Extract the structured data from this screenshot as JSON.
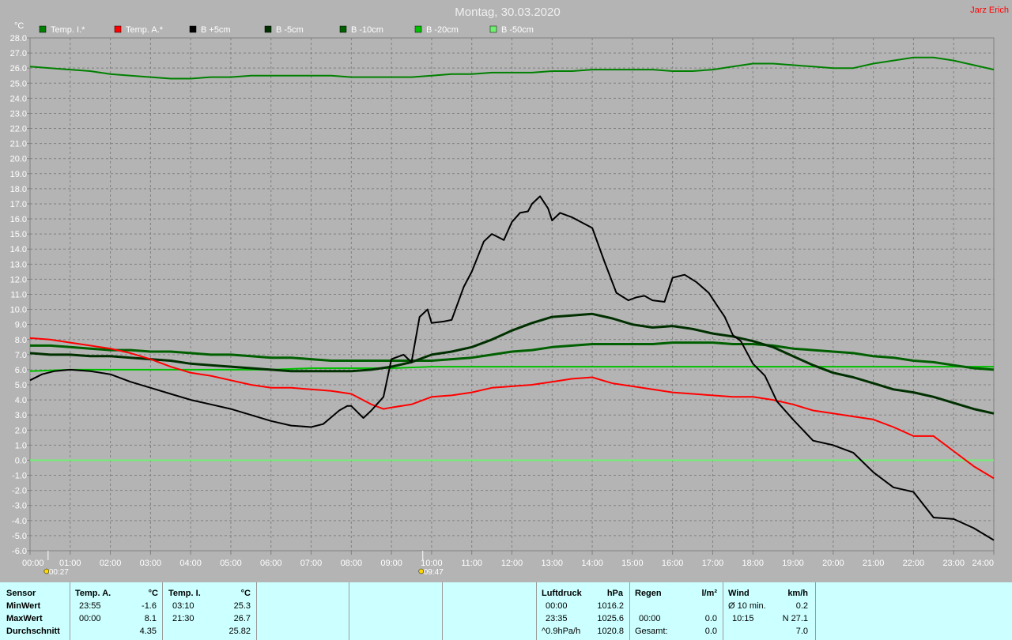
{
  "header": {
    "title": "Montag, 30.03.2020",
    "author": "Jarz Erich",
    "unit": "°C"
  },
  "colors": {
    "background": "#b4b4b4",
    "grid": "#808080",
    "title": "#f0f0f0",
    "author": "#ff0000",
    "axis_text": "#ffffff",
    "stats_bg": "#ccffff"
  },
  "chart_data": {
    "type": "line",
    "title": "Montag, 30.03.2020",
    "ylabel": "°C",
    "xlabel": "",
    "ylim": [
      -6,
      28
    ],
    "xlim": [
      0,
      24
    ],
    "grid": true,
    "legend_position": "top",
    "x_tick_labels": [
      "00:00",
      "01:00",
      "02:00",
      "03:00",
      "04:00",
      "05:00",
      "06:00",
      "07:00",
      "08:00",
      "09:00",
      "10:00",
      "11:00",
      "12:00",
      "13:00",
      "14:00",
      "15:00",
      "16:00",
      "17:00",
      "18:00",
      "19:00",
      "20:00",
      "21:00",
      "22:00",
      "23:00",
      "24:00"
    ],
    "y_tick_labels": [
      "28.0",
      "27.0",
      "26.0",
      "25.0",
      "24.0",
      "23.0",
      "22.0",
      "21.0",
      "20.0",
      "19.0",
      "18.0",
      "17.0",
      "16.0",
      "15.0",
      "14.0",
      "13.0",
      "12.0",
      "11.0",
      "10.0",
      "9.0",
      "8.0",
      "7.0",
      "6.0",
      "5.0",
      "4.0",
      "3.0",
      "2.0",
      "1.0",
      "0.0",
      "-1.0",
      "-2.0",
      "-3.0",
      "-4.0",
      "-5.0",
      "-6.0"
    ],
    "series": [
      {
        "name": "Temp. I.*",
        "color": "#008000",
        "width": 2,
        "x": [
          0,
          0.5,
          1,
          1.5,
          2,
          2.5,
          3,
          3.5,
          4,
          4.5,
          5,
          5.5,
          6,
          6.5,
          7,
          7.5,
          8,
          8.5,
          9,
          9.5,
          10,
          10.5,
          11,
          11.5,
          12,
          12.5,
          13,
          13.5,
          14,
          14.5,
          15,
          15.5,
          16,
          16.5,
          17,
          17.5,
          18,
          18.5,
          19,
          19.5,
          20,
          20.5,
          21,
          21.5,
          22,
          22.5,
          23,
          23.5,
          24
        ],
        "y": [
          26.1,
          26.0,
          25.9,
          25.8,
          25.6,
          25.5,
          25.4,
          25.3,
          25.3,
          25.4,
          25.4,
          25.5,
          25.5,
          25.5,
          25.5,
          25.5,
          25.4,
          25.4,
          25.4,
          25.4,
          25.5,
          25.6,
          25.6,
          25.7,
          25.7,
          25.7,
          25.8,
          25.8,
          25.9,
          25.9,
          25.9,
          25.9,
          25.8,
          25.8,
          25.9,
          26.1,
          26.3,
          26.3,
          26.2,
          26.1,
          26.0,
          26.0,
          26.3,
          26.5,
          26.7,
          26.7,
          26.5,
          26.2,
          25.9
        ]
      },
      {
        "name": "Temp. A.*",
        "color": "#ff0000",
        "width": 2,
        "x": [
          0,
          0.5,
          1,
          1.5,
          2,
          2.5,
          3,
          3.5,
          4,
          4.5,
          5,
          5.5,
          6,
          6.5,
          7,
          7.5,
          8,
          8.5,
          8.8,
          9,
          9.5,
          10,
          10.5,
          11,
          11.5,
          12,
          12.5,
          13,
          13.5,
          14,
          14.5,
          15,
          15.5,
          16,
          16.5,
          17,
          17.5,
          18,
          18.5,
          19,
          19.5,
          20,
          20.5,
          21,
          21.5,
          22,
          22.5,
          23,
          23.5,
          24
        ],
        "y": [
          8.1,
          8.0,
          7.8,
          7.6,
          7.4,
          7.1,
          6.7,
          6.2,
          5.8,
          5.6,
          5.3,
          5.0,
          4.8,
          4.8,
          4.7,
          4.6,
          4.4,
          3.7,
          3.4,
          3.5,
          3.7,
          4.2,
          4.3,
          4.5,
          4.8,
          4.9,
          5.0,
          5.2,
          5.4,
          5.5,
          5.1,
          4.9,
          4.7,
          4.5,
          4.4,
          4.3,
          4.2,
          4.2,
          4.0,
          3.7,
          3.3,
          3.1,
          2.9,
          2.7,
          2.2,
          1.6,
          1.6,
          0.6,
          -0.4,
          -1.2
        ]
      },
      {
        "name": "B +5cm",
        "color": "#000000",
        "width": 2,
        "x": [
          0,
          0.3,
          0.6,
          1,
          1.5,
          2,
          2.5,
          3,
          3.5,
          4,
          4.5,
          5,
          5.5,
          6,
          6.5,
          7,
          7.3,
          7.7,
          7.9,
          8,
          8.3,
          8.5,
          8.8,
          9,
          9.3,
          9.5,
          9.7,
          9.9,
          10,
          10.3,
          10.5,
          10.8,
          11,
          11.3,
          11.5,
          11.8,
          12,
          12.2,
          12.4,
          12.5,
          12.7,
          12.9,
          13,
          13.2,
          13.5,
          14,
          14.3,
          14.6,
          14.9,
          15.1,
          15.3,
          15.5,
          15.8,
          16,
          16.3,
          16.6,
          16.9,
          17.1,
          17.3,
          17.5,
          17.7,
          18,
          18.3,
          18.6,
          19,
          19.5,
          20,
          20.5,
          21,
          21.5,
          22,
          22.5,
          23,
          23.5,
          24
        ],
        "y": [
          5.3,
          5.7,
          5.9,
          6.0,
          5.9,
          5.7,
          5.2,
          4.8,
          4.4,
          4.0,
          3.7,
          3.4,
          3.0,
          2.6,
          2.3,
          2.2,
          2.4,
          3.3,
          3.6,
          3.6,
          2.8,
          3.3,
          4.2,
          6.7,
          7.0,
          6.5,
          9.5,
          10.0,
          9.1,
          9.2,
          9.3,
          11.5,
          12.5,
          14.5,
          15.0,
          14.6,
          15.8,
          16.4,
          16.5,
          17.0,
          17.5,
          16.7,
          15.9,
          16.4,
          16.1,
          15.4,
          13.2,
          11.1,
          10.6,
          10.8,
          10.9,
          10.6,
          10.5,
          12.1,
          12.3,
          11.8,
          11.1,
          10.3,
          9.5,
          8.3,
          7.9,
          6.4,
          5.6,
          3.9,
          2.7,
          1.3,
          1.0,
          0.5,
          -0.8,
          -1.8,
          -2.1,
          -3.8,
          -3.9,
          -4.5,
          -5.3
        ]
      },
      {
        "name": "B -5cm",
        "color": "#003000",
        "width": 3,
        "x": [
          0,
          0.5,
          1,
          1.5,
          2,
          2.5,
          3,
          3.5,
          4,
          4.5,
          5,
          5.5,
          6,
          6.5,
          7,
          7.5,
          8,
          8.5,
          9,
          9.5,
          10,
          10.5,
          11,
          11.5,
          12,
          12.5,
          13,
          13.5,
          14,
          14.5,
          15,
          15.5,
          16,
          16.5,
          17,
          17.5,
          18,
          18.5,
          19,
          19.5,
          20,
          20.5,
          21,
          21.5,
          22,
          22.5,
          23,
          23.5,
          24
        ],
        "y": [
          7.1,
          7.0,
          7.0,
          6.9,
          6.9,
          6.8,
          6.7,
          6.6,
          6.4,
          6.3,
          6.2,
          6.1,
          6.0,
          5.9,
          5.9,
          5.9,
          5.9,
          6.0,
          6.2,
          6.5,
          7.0,
          7.2,
          7.5,
          8.0,
          8.6,
          9.1,
          9.5,
          9.6,
          9.7,
          9.4,
          9.0,
          8.8,
          8.9,
          8.7,
          8.4,
          8.2,
          7.9,
          7.5,
          6.9,
          6.3,
          5.8,
          5.5,
          5.1,
          4.7,
          4.5,
          4.2,
          3.8,
          3.4,
          3.1
        ]
      },
      {
        "name": "B -10cm",
        "color": "#006000",
        "width": 3,
        "x": [
          0,
          0.5,
          1,
          1.5,
          2,
          2.5,
          3,
          3.5,
          4,
          4.5,
          5,
          5.5,
          6,
          6.5,
          7,
          7.5,
          8,
          8.5,
          9,
          9.5,
          10,
          10.5,
          11,
          11.5,
          12,
          12.5,
          13,
          13.5,
          14,
          14.5,
          15,
          15.5,
          16,
          16.5,
          17,
          17.5,
          18,
          18.5,
          19,
          19.5,
          20,
          20.5,
          21,
          21.5,
          22,
          22.5,
          23,
          23.5,
          24
        ],
        "y": [
          7.6,
          7.6,
          7.5,
          7.4,
          7.3,
          7.3,
          7.2,
          7.2,
          7.1,
          7.0,
          7.0,
          6.9,
          6.8,
          6.8,
          6.7,
          6.6,
          6.6,
          6.6,
          6.6,
          6.6,
          6.6,
          6.7,
          6.8,
          7.0,
          7.2,
          7.3,
          7.5,
          7.6,
          7.7,
          7.7,
          7.7,
          7.7,
          7.8,
          7.8,
          7.8,
          7.7,
          7.7,
          7.6,
          7.4,
          7.3,
          7.2,
          7.1,
          6.9,
          6.8,
          6.6,
          6.5,
          6.3,
          6.1,
          6.0
        ]
      },
      {
        "name": "B -20cm",
        "color": "#00c000",
        "width": 2,
        "x": [
          0,
          1,
          2,
          3,
          4,
          5,
          6,
          7,
          8,
          9,
          10,
          11,
          12,
          13,
          14,
          15,
          16,
          17,
          18,
          19,
          20,
          21,
          22,
          23,
          24
        ],
        "y": [
          5.9,
          6.0,
          6.0,
          6.0,
          6.0,
          6.0,
          6.0,
          6.1,
          6.1,
          6.1,
          6.2,
          6.2,
          6.2,
          6.2,
          6.2,
          6.2,
          6.2,
          6.2,
          6.2,
          6.2,
          6.2,
          6.2,
          6.2,
          6.2,
          6.2
        ]
      },
      {
        "name": "B -50cm",
        "color": "#70f070",
        "width": 2,
        "x": [
          0,
          24
        ],
        "y": [
          0.0,
          0.0
        ]
      }
    ],
    "markers": [
      {
        "time": "00:27",
        "x": 0.45
      },
      {
        "time": "09:47",
        "x": 9.78
      }
    ]
  },
  "stats": {
    "sensor": {
      "header": "Sensor",
      "rows": [
        "MinWert",
        "MaxWert",
        "Durchschnitt"
      ]
    },
    "temp_a": {
      "header": "Temp. A.",
      "unit": "°C",
      "min_time": "23:55",
      "min_val": "-1.6",
      "max_time": "00:00",
      "max_val": "8.1",
      "avg": "4.35"
    },
    "temp_i": {
      "header": "Temp. I.",
      "unit": "°C",
      "min_time": "03:10",
      "min_val": "25.3",
      "max_time": "21:30",
      "max_val": "26.7",
      "avg": "25.82"
    },
    "luftdruck": {
      "header": "Luftdruck",
      "unit": "hPa",
      "min_time": "00:00",
      "min_val": "1016.2",
      "max_time": "23:35",
      "max_val": "1025.6",
      "trend_label": "^0.9hPa/h",
      "avg": "1020.8"
    },
    "regen": {
      "header": "Regen",
      "unit": "l/m²",
      "max_time": "00:00",
      "max_val": "0.0",
      "total_label": "Gesamt:",
      "total": "0.0"
    },
    "wind": {
      "header": "Wind",
      "unit": "km/h",
      "avg_label": "Ø 10 min.",
      "avg_val": "0.2",
      "max_time": "10:15",
      "max_val": "N 27.1",
      "last": "7.0"
    }
  }
}
